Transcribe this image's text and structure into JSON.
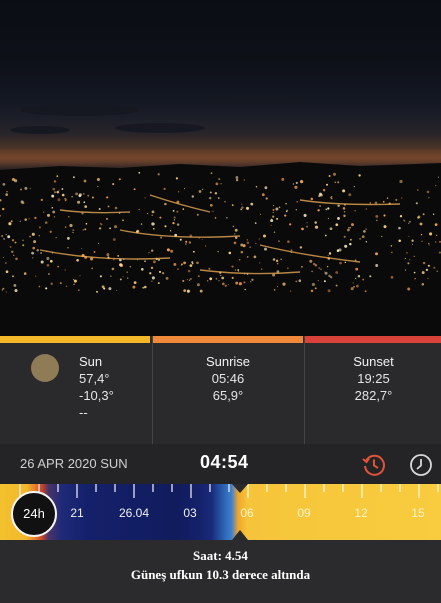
{
  "sun_panel": {
    "label": "Sun",
    "azimuth": "57,4°",
    "altitude": "-10,3°",
    "extra": "--",
    "bar_color": "#f3b92a"
  },
  "sunrise_panel": {
    "label": "Sunrise",
    "time": "05:46",
    "azimuth": "65,9°",
    "bar_color": "#f0893a"
  },
  "sunset_panel": {
    "label": "Sunset",
    "time": "19:25",
    "azimuth": "282,7°",
    "bar_color": "#d94238"
  },
  "date_row": {
    "date": "26 APR 2020 SUN",
    "time": "04:54"
  },
  "timeline": {
    "mode_button": "24h",
    "tick_labels": [
      "21",
      "26.04",
      "03",
      "06",
      "09",
      "12",
      "15"
    ]
  },
  "caption": {
    "line1": "Saat: 4.54",
    "line2": "Güneş ufkun 10.3 derece altında"
  },
  "icons": {
    "history": "history-clock-icon",
    "clock": "clock-icon"
  },
  "colors": {
    "accent_history": "#e0533a",
    "night_band": "#14206a",
    "day_band": "#f8cc3e"
  }
}
